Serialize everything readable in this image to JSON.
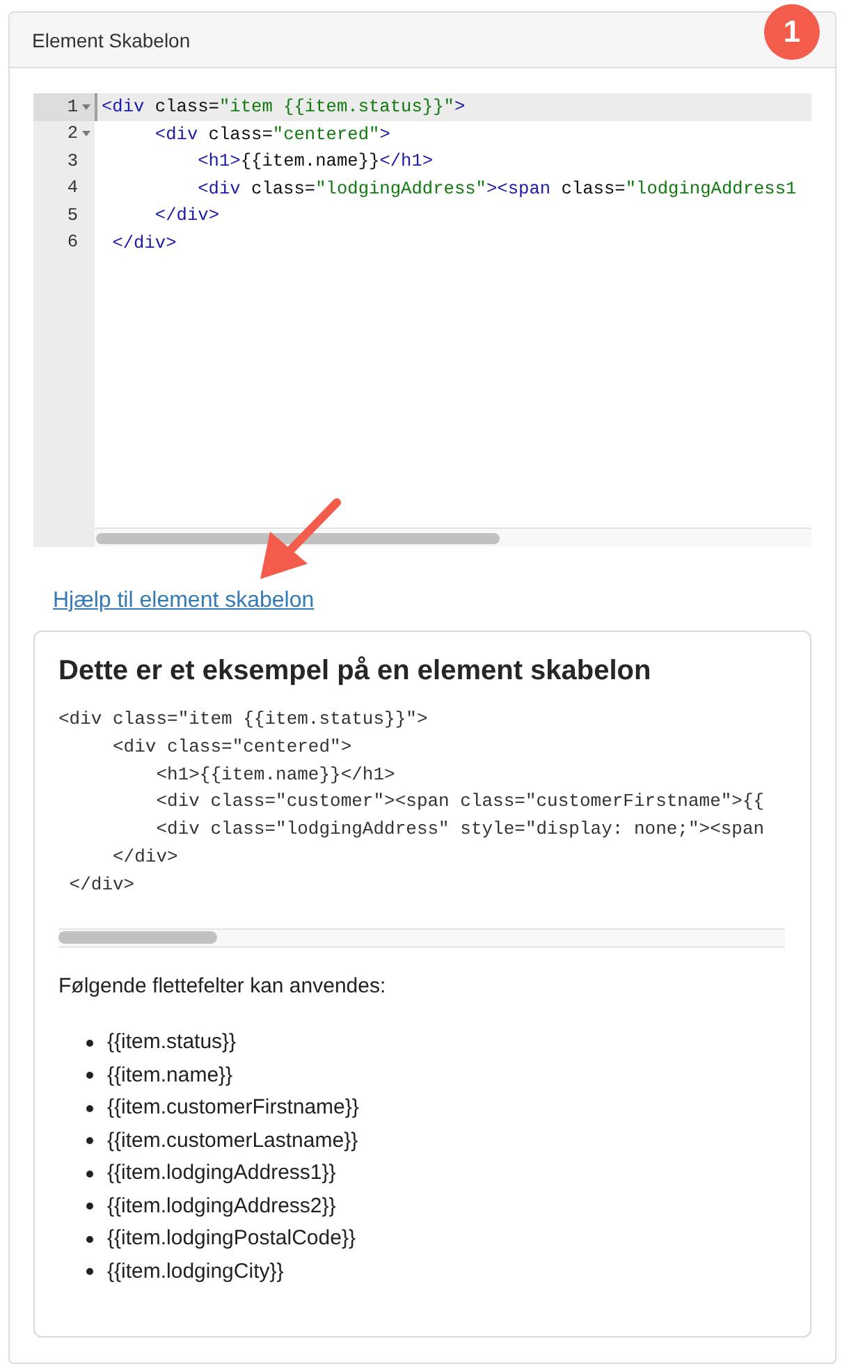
{
  "panel": {
    "title": "Element Skabelon"
  },
  "step_badge": "1",
  "editor": {
    "lines": [
      {
        "number": "1",
        "text": "<div class=\"item {{item.status}}\">",
        "foldable": true,
        "active": true
      },
      {
        "number": "2",
        "text": "     <div class=\"centered\">",
        "foldable": true,
        "active": false
      },
      {
        "number": "3",
        "text": "         <h1>{{item.name}}</h1>",
        "foldable": false,
        "active": false
      },
      {
        "number": "4",
        "text": "         <div class=\"lodgingAddress\"><span class=\"lodgingAddress1",
        "foldable": false,
        "active": false
      },
      {
        "number": "5",
        "text": "     </div>",
        "foldable": false,
        "active": false
      },
      {
        "number": "6",
        "text": " </div>",
        "foldable": false,
        "active": false
      }
    ]
  },
  "help_link": "Hjælp til element skabelon",
  "help_card": {
    "heading": "Dette er et eksempel på en element skabelon",
    "example_code": [
      "<div class=\"item {{item.status}}\">",
      "     <div class=\"centered\">",
      "         <h1>{{item.name}}</h1>",
      "         <div class=\"customer\"><span class=\"customerFirstname\">{{",
      "         <div class=\"lodgingAddress\" style=\"display: none;\"><span",
      "     </div>",
      " </div>"
    ],
    "intro": "Følgende flettefelter kan anvendes:",
    "fields": [
      "{{item.status}}",
      "{{item.name}}",
      "{{item.customerFirstname}}",
      "{{item.customerLastname}}",
      "{{item.lodgingAddress1}}",
      "{{item.lodgingAddress2}}",
      "{{item.lodgingPostalCode}}",
      "{{item.lodgingCity}}"
    ]
  }
}
